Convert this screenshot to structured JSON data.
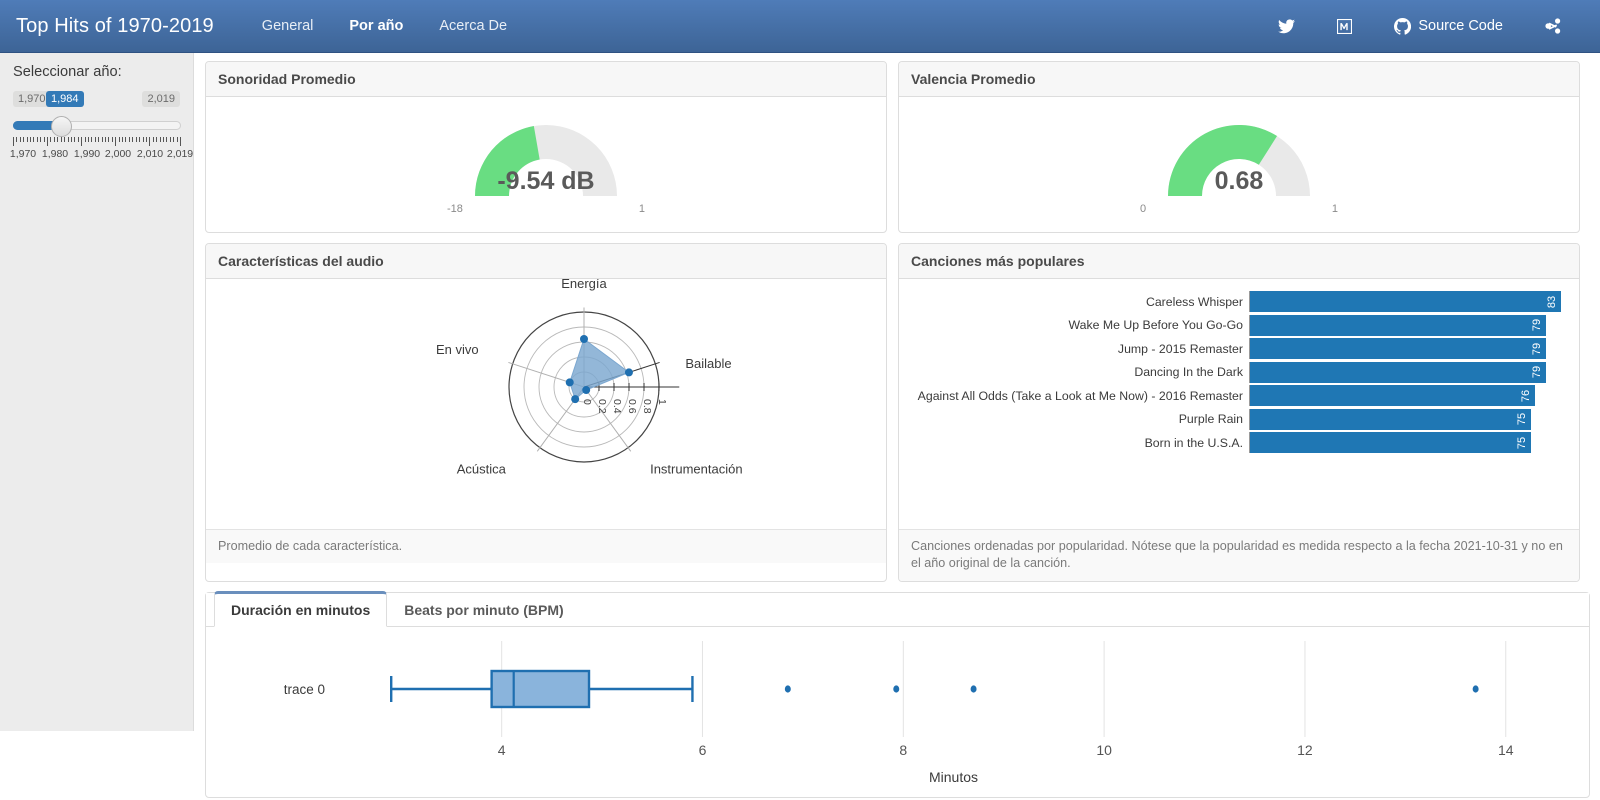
{
  "navbar": {
    "brand": "Top Hits of 1970-2019",
    "links": [
      {
        "label": "General",
        "active": false
      },
      {
        "label": "Por año",
        "active": true
      },
      {
        "label": "Acerca De",
        "active": false
      }
    ],
    "icons": [
      {
        "name": "twitter-icon",
        "label": ""
      },
      {
        "name": "medium-icon",
        "label": ""
      },
      {
        "name": "github-icon",
        "label": "Source Code"
      },
      {
        "name": "share-icon",
        "label": ""
      }
    ],
    "source_code_label": "Source Code"
  },
  "sidebar": {
    "title": "Seleccionar año:",
    "slider": {
      "min_label": "1,970",
      "max_label": "2,019",
      "current_label": "1,984",
      "min": 1970,
      "max": 2019,
      "value": 1984,
      "scale_labels": [
        "1,970",
        "1,980",
        "1,990",
        "2,000",
        "2,010",
        "2,019"
      ]
    }
  },
  "cards": {
    "loudness": {
      "title": "Sonoridad Promedio",
      "value_label": "-9.54 dB",
      "value": -9.54,
      "min_label": "-18",
      "max_label": "1",
      "min": -18,
      "max": 1,
      "color": "#64dd7d",
      "track_color": "#e8e8e8"
    },
    "valence": {
      "title": "Valencia Promedio",
      "value_label": "0.68",
      "value": 0.68,
      "min_label": "0",
      "max_label": "1",
      "min": 0,
      "max": 1,
      "color": "#64dd7d",
      "track_color": "#e8e8e8"
    },
    "audio_features": {
      "title": "Características del audio",
      "footer": "Promedio de cada característica."
    },
    "top_songs": {
      "title": "Canciones más populares",
      "footer": "Canciones ordenadas por popularidad. Nótese que la popularidad es medida respecto a la fecha 2021-10-31 y no en el año original de la canción."
    }
  },
  "tabs": [
    {
      "label": "Duración en minutos",
      "active": true
    },
    {
      "label": "Beats por minuto (BPM)",
      "active": false
    }
  ],
  "chart_data": [
    {
      "type": "gauge",
      "title": "Sonoridad Promedio",
      "value": -9.54,
      "value_label": "-9.54 dB",
      "min": -18,
      "max": 1,
      "tick_labels": [
        "-18",
        "1"
      ],
      "bar_color": "#64dd7d"
    },
    {
      "type": "gauge",
      "title": "Valencia Promedio",
      "value": 0.68,
      "value_label": "0.68",
      "min": 0,
      "max": 1,
      "tick_labels": [
        "0",
        "1"
      ],
      "bar_color": "#64dd7d"
    },
    {
      "type": "radar",
      "title": "Características del audio",
      "categories": [
        "Energía",
        "Bailable",
        "Instrumentación",
        "Acústica",
        "En vivo"
      ],
      "values": [
        0.64,
        0.63,
        0.05,
        0.2,
        0.2
      ],
      "radial_ticks": [
        "0",
        "0.2",
        "0.4",
        "0.6",
        "0.8",
        "1"
      ],
      "rlim": [
        0,
        1
      ],
      "fill_color": "#7ba7d0",
      "marker_color": "#1f6fb0",
      "grid": true,
      "legend": "none"
    },
    {
      "type": "bar",
      "orientation": "horizontal",
      "title": "Canciones más populares",
      "categories": [
        "Careless Whisper",
        "Wake Me Up Before You Go-Go",
        "Jump - 2015 Remaster",
        "Dancing In the Dark",
        "Against All Odds (Take a Look at Me Now) - 2016 Remaster",
        "Purple Rain",
        "Born in the U.S.A."
      ],
      "values": [
        83,
        79,
        79,
        79,
        76,
        75,
        75
      ],
      "xlabel": "",
      "ylabel": "",
      "xlim": [
        0,
        83
      ],
      "bar_color": "#1f77b4",
      "grid": false,
      "legend": "none"
    },
    {
      "type": "box",
      "title": "Duración en minutos",
      "trace_label": "trace 0",
      "xlabel": "Minutos",
      "xlim": [
        2.4,
        14.6
      ],
      "x_ticks": [
        4,
        6,
        8,
        10,
        12,
        14
      ],
      "x_tick_labels": [
        "4",
        "6",
        "8",
        "10",
        "12",
        "14"
      ],
      "box": {
        "whisker_low": 2.9,
        "q1": 3.9,
        "median": 4.12,
        "q3": 4.87,
        "whisker_high": 5.9
      },
      "outliers": [
        6.85,
        7.93,
        8.7,
        13.7
      ],
      "box_fill": "#8ab4dc",
      "box_line": "#1f6fb0",
      "grid": true,
      "legend": "none"
    }
  ],
  "boxplot_axis_label": "Minutos",
  "boxplot_trace_label": "trace 0"
}
